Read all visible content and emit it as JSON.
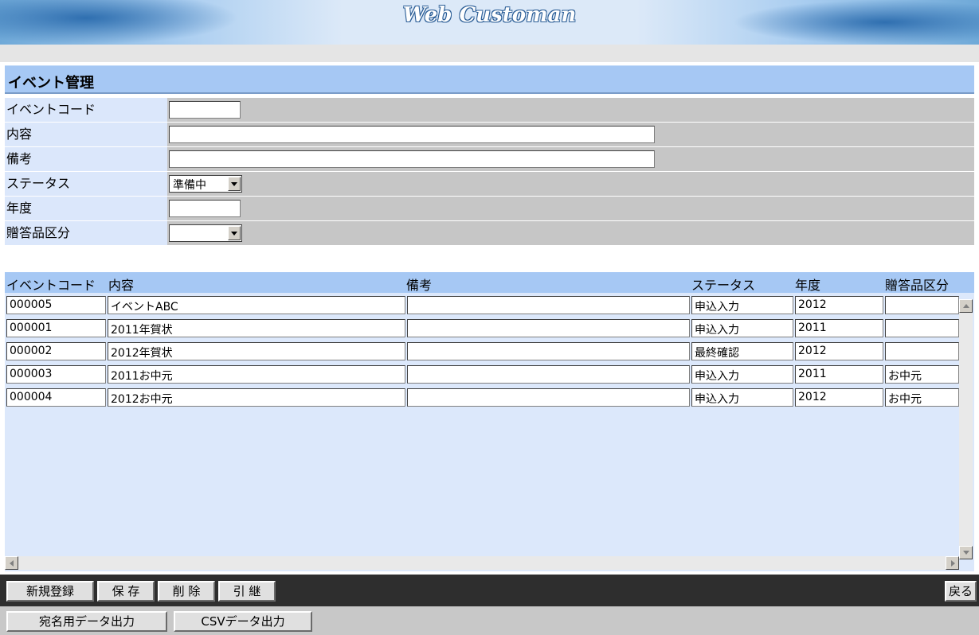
{
  "app": {
    "title": "Web Customan"
  },
  "page": {
    "title": "イベント管理"
  },
  "form": {
    "event_code_label": "イベントコード",
    "event_code_value": "",
    "content_label": "内容",
    "content_value": "",
    "remarks_label": "備考",
    "remarks_value": "",
    "status_label": "ステータス",
    "status_value": "準備中",
    "year_label": "年度",
    "year_value": "",
    "gift_label": "贈答品区分",
    "gift_value": ""
  },
  "grid": {
    "headers": {
      "code": "イベントコード",
      "content": "内容",
      "remarks": "備考",
      "status": "ステータス",
      "year": "年度",
      "gift": "贈答品区分"
    },
    "rows": [
      {
        "code": "000005",
        "content": "イベントABC",
        "remarks": "",
        "status": "申込入力",
        "year": "2012",
        "gift": ""
      },
      {
        "code": "000001",
        "content": "2011年賀状",
        "remarks": "",
        "status": "申込入力",
        "year": "2011",
        "gift": ""
      },
      {
        "code": "000002",
        "content": "2012年賀状",
        "remarks": "",
        "status": "最終確認",
        "year": "2012",
        "gift": ""
      },
      {
        "code": "000003",
        "content": "2011お中元",
        "remarks": "",
        "status": "申込入力",
        "year": "2011",
        "gift": "お中元"
      },
      {
        "code": "000004",
        "content": "2012お中元",
        "remarks": "",
        "status": "申込入力",
        "year": "2012",
        "gift": "お中元"
      }
    ]
  },
  "toolbar": {
    "new": "新規登録",
    "save": "保 存",
    "delete": "削 除",
    "inherit": "引 継",
    "back": "戻る"
  },
  "bottom": {
    "address_export": "宛名用データ出力",
    "csv_export": "CSVデータ出力"
  }
}
